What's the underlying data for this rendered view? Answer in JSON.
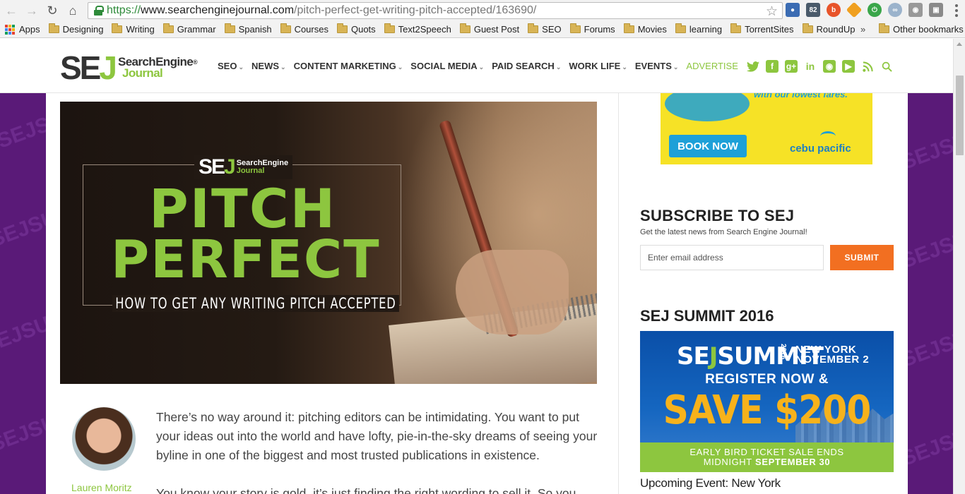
{
  "browser": {
    "url_scheme": "https://",
    "url_host": "www.searchenginejournal.com",
    "url_path": "/pitch-perfect-get-writing-pitch-accepted/163690/",
    "extension_badge": "82",
    "bookmarks": [
      "Apps",
      "Designing",
      "Writing",
      "Grammar",
      "Spanish",
      "Courses",
      "Quots",
      "Text2Speech",
      "Guest Post",
      "SEO",
      "Forums",
      "Movies",
      "learning",
      "TorrentSites",
      "RoundUp"
    ],
    "bookmarks_overflow": "»",
    "other_bookmarks": "Other bookmarks"
  },
  "header": {
    "logo_sej_s": "SE",
    "logo_sej_j": "J",
    "logo_line1": "SearchEngine",
    "logo_line2": "Journal",
    "logo_reg": "®",
    "nav": [
      "SEO",
      "NEWS",
      "CONTENT MARKETING",
      "SOCIAL MEDIA",
      "PAID SEARCH",
      "WORK LIFE",
      "EVENTS"
    ],
    "nav_advertise": "ADVERTISE",
    "caret": "⌄",
    "social_icons": [
      "twitter-icon",
      "facebook-icon",
      "google-plus-icon",
      "linkedin-icon",
      "instagram-icon",
      "youtube-icon",
      "rss-icon",
      "search-icon"
    ]
  },
  "hero": {
    "brand_s": "SE",
    "brand_j": "J",
    "brand_line1": "SearchEngine",
    "brand_line2": "Journal",
    "title_line1": "PITCH",
    "title_line2": "PERFECT",
    "subtitle": "HOW TO GET ANY WRITING PITCH ACCEPTED"
  },
  "article": {
    "author": "Lauren Moritz",
    "p1": "There’s no way around it: pitching editors can be intimidating. You want to put your ideas out into the world and have lofty, pie-in-the-sky dreams of seeing your byline in one of the biggest and most trusted publications in existence.",
    "p2": "You know your story is gold, it’s just finding the right wording to sell it. So you"
  },
  "sidebar": {
    "ad_top": {
      "tagline": "with our lowest fares.",
      "button": "BOOK NOW",
      "brand": "cebu pacific"
    },
    "subscribe": {
      "title": "SUBSCRIBE TO SEJ",
      "desc": "Get the latest news from Search Engine Journal!",
      "placeholder": "Enter email address",
      "button": "SUBMIT"
    },
    "summit": {
      "title": "SEJ SUMMIT 2016",
      "ad_logo_se": "SE",
      "ad_logo_j": "J",
      "ad_logo_summit": "SUMMIT",
      "ad_year": "2016",
      "ad_location_1": "NEW YORK",
      "ad_location_2": "NOVEMBER 2",
      "ad_register": "REGISTER NOW &",
      "ad_save": "SAVE $200",
      "ad_bar_1": "EARLY BIRD TICKET SALE ENDS",
      "ad_bar_2a": "MIDNIGHT",
      "ad_bar_2b": "SEPTEMBER 30",
      "upcoming": "Upcoming Event: New York"
    }
  },
  "background_watermark": "SEJSUMMIT 2016",
  "colors": {
    "brand_green": "#8dc63f",
    "accent_orange": "#f26f21",
    "bg_purple": "#5a1a78"
  }
}
